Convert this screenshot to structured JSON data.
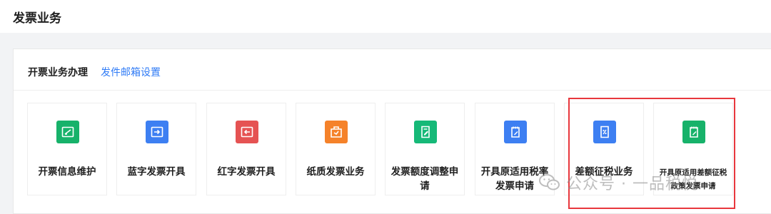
{
  "header": {
    "title": "发票业务"
  },
  "tabs": [
    {
      "label": "开票业务办理"
    },
    {
      "label": "发件邮箱设置"
    }
  ],
  "tiles": [
    {
      "label": "开票信息维护",
      "icon": "invoice-info-icon",
      "color": "#17b26a"
    },
    {
      "label": "蓝字发票开具",
      "icon": "blue-invoice-icon",
      "color": "#3d7ff2"
    },
    {
      "label": "红字发票开具",
      "icon": "red-invoice-icon",
      "color": "#e55353"
    },
    {
      "label": "纸质发票业务",
      "icon": "paper-invoice-icon",
      "color": "#f5822a"
    },
    {
      "label": "发票额度调整申请",
      "icon": "quota-adjust-icon",
      "color": "#16b978"
    },
    {
      "label": "开具原适用税率发票申请",
      "icon": "original-rate-icon",
      "color": "#3d7ff2"
    },
    {
      "label": "差额征税业务",
      "icon": "differential-tax-icon",
      "color": "#3d7ff2"
    },
    {
      "label": "开具原适用差额征税政策发票申请",
      "icon": "differential-policy-icon",
      "color": "#17b26a"
    }
  ],
  "watermark": {
    "text": "公众号 · 一品税悦"
  }
}
